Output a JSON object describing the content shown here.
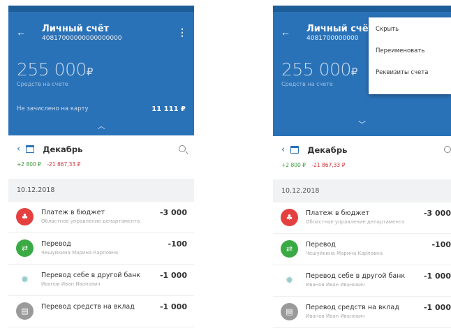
{
  "left": {
    "title": "Личный счёт",
    "account_number": "40817000000000000000",
    "balance": "255 000",
    "currency": "₽",
    "balance_caption": "Средств на счете",
    "not_credited_label": "Не зачислено на карту",
    "not_credited_value": "11 111 ₽",
    "month": "Декабрь",
    "income": "+2 800 ₽",
    "expense": "-21 867,33 ₽",
    "date": "10.12.2018",
    "transactions": [
      {
        "title": "Платеж в бюджет",
        "subtitle": "Областное управление департамента",
        "amount": "-3 000"
      },
      {
        "title": "Перевод",
        "subtitle": "Чешуйкина Марина Карповна",
        "amount": "-100"
      },
      {
        "title": "Перевод себе в другой банк",
        "subtitle": "Иванов Иван Иванович",
        "amount": "-1 000"
      },
      {
        "title": "Перевод средств на вклад",
        "subtitle": "",
        "amount": "-1 000"
      }
    ]
  },
  "right": {
    "title": "Личный счёт",
    "account_number": "4081700000000",
    "balance": "255 000",
    "currency": "₽",
    "balance_caption": "Средств на счете",
    "month": "Декабрь",
    "income": "+2 800 ₽",
    "expense": "-21 867,33 ₽",
    "date": "10.12.2018",
    "menu": [
      "Скрыть",
      "Переименовать",
      "Реквизиты счета"
    ],
    "transactions": [
      {
        "title": "Платеж в бюджет",
        "subtitle": "Областное управление департамента",
        "amount": "-3 000"
      },
      {
        "title": "Перевод",
        "subtitle": "Чешуйкина Марина Карповна",
        "amount": "-100"
      },
      {
        "title": "Перевод себе в другой банк",
        "subtitle": "Иванов Иван Иванович",
        "amount": "-1 000"
      },
      {
        "title": "Перевод средств на вклад",
        "subtitle": "Иванов Иван Иванович",
        "amount": "-1 000"
      }
    ]
  },
  "icons": {
    "back": "arrow-left-icon",
    "more": "more-vertical-icon",
    "chevron_up": "chevron-up-icon",
    "chevron_down": "chevron-down-icon",
    "calendar": "calendar-icon",
    "search": "search-icon"
  },
  "colors": {
    "header": "#2a72b8",
    "statusbar": "#1f5d98",
    "income": "#3a9a3a",
    "expense": "#d0333a"
  }
}
